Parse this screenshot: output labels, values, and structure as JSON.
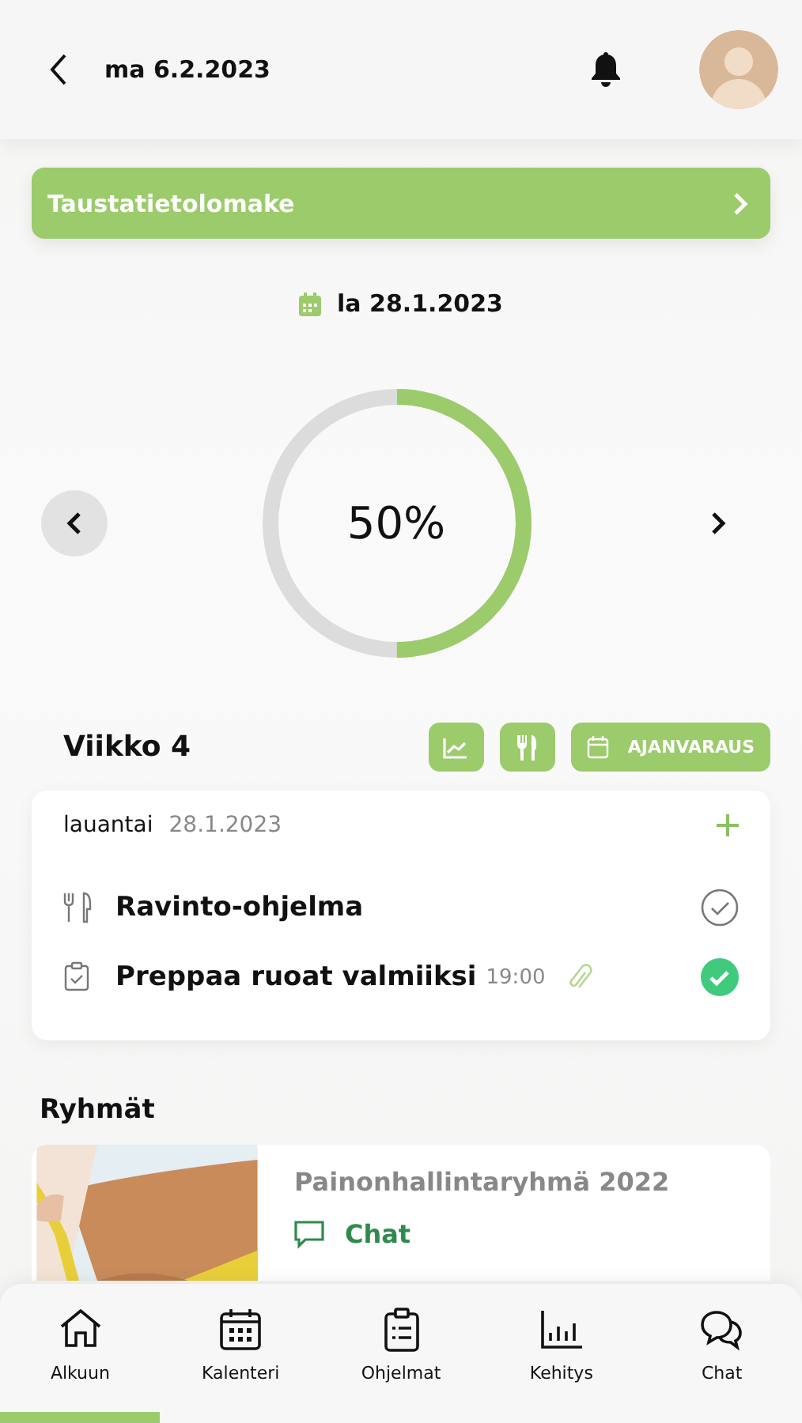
{
  "header": {
    "date": "ma 6.2.2023"
  },
  "banner": {
    "label": "Taustatietolomake"
  },
  "day": {
    "date": "la 28.1.2023"
  },
  "progress": {
    "level": 0.5,
    "reading": "50%"
  },
  "week": {
    "title": "Viikko 4",
    "booking_label": "AJANVARAUS"
  },
  "day_card": {
    "weekday": "lauantai",
    "date": "28.1.2023",
    "tasks": [
      {
        "kind": "nutrition",
        "title": "Ravinto-ohjelma",
        "done": false
      },
      {
        "kind": "task",
        "title": "Preppaa ruoat valmiiksi",
        "time": "19:00",
        "attachment": true,
        "done": true
      }
    ]
  },
  "groups": {
    "title": "Ryhmät",
    "items": [
      {
        "kind": "picture",
        "name": "Painonhallintaryhmä 2022",
        "link": "Chat"
      }
    ]
  },
  "nav": [
    {
      "kind": "home",
      "label": "Alkuun",
      "selected": true
    },
    {
      "kind": "calendar",
      "label": "Kalenteri",
      "selected": false
    },
    {
      "kind": "programs",
      "label": "Ohjelmat",
      "selected": false
    },
    {
      "kind": "progress",
      "label": "Kehitys",
      "selected": false
    },
    {
      "kind": "chat",
      "label": "Chat",
      "selected": false
    }
  ]
}
